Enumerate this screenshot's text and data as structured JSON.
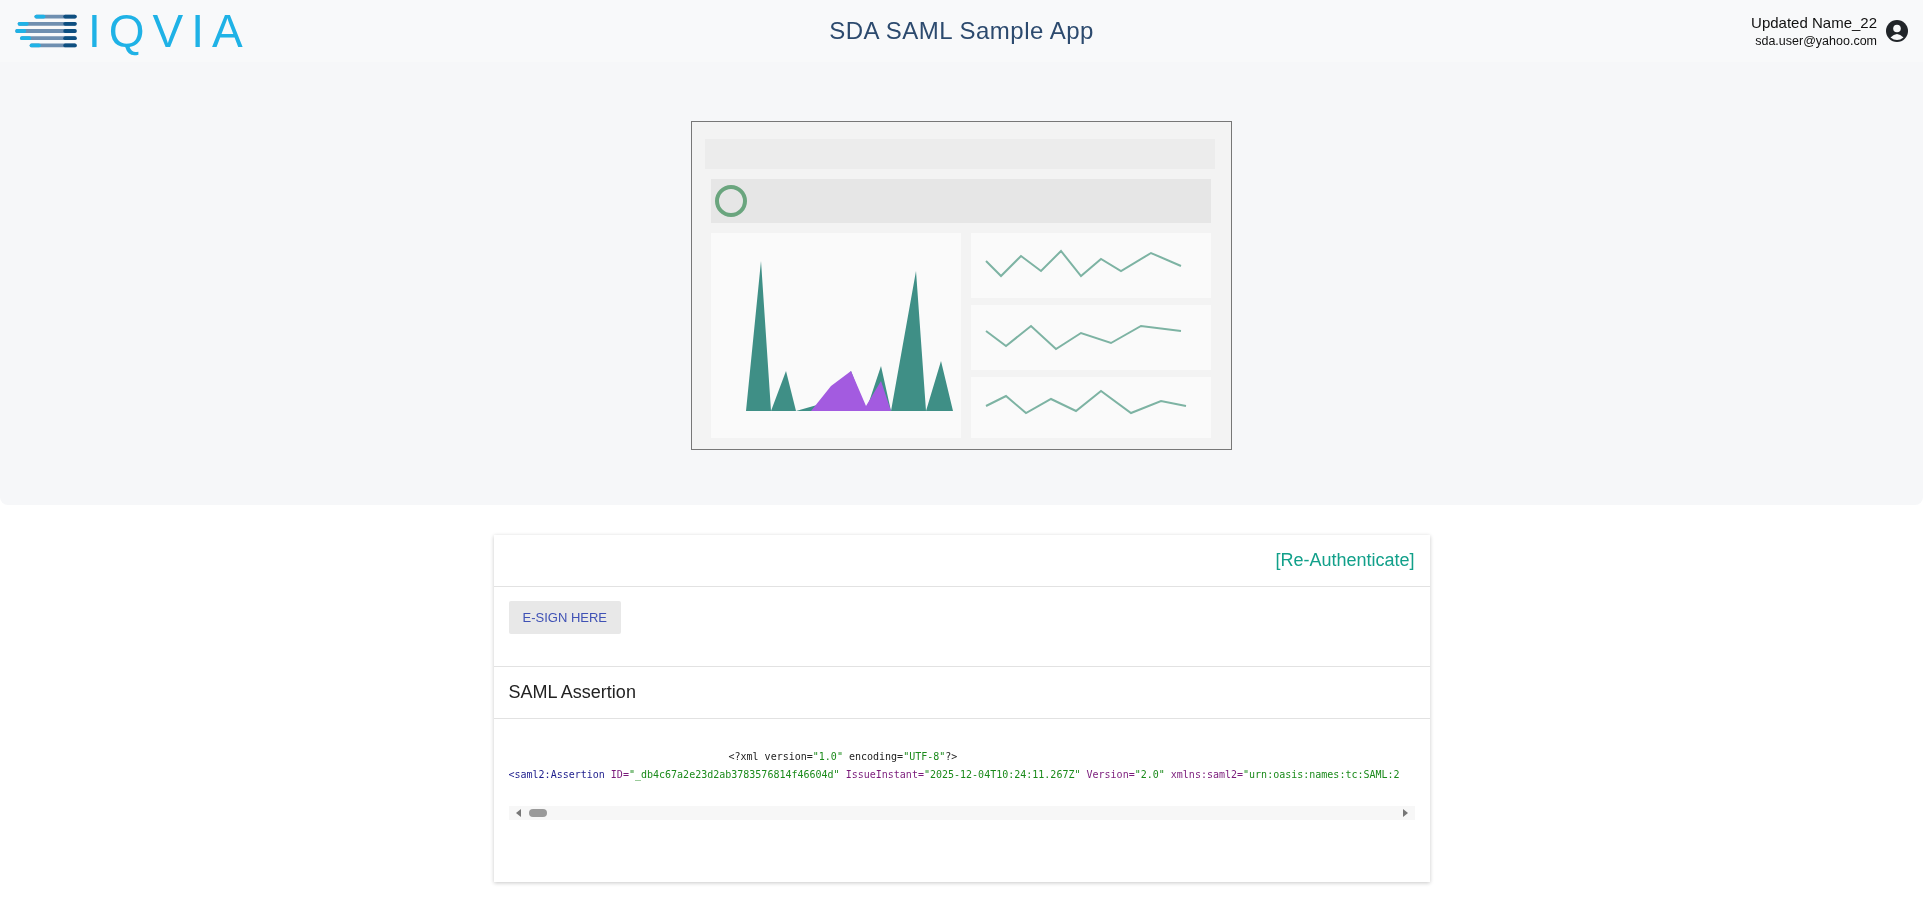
{
  "header": {
    "logo_text": "IQVIA",
    "title": "SDA SAML Sample App",
    "user": {
      "name": "Updated Name_22",
      "email": "sda.user@yahoo.com"
    }
  },
  "card": {
    "reauth_link": "[Re-Authenticate]",
    "esign_button": "E-SIGN HERE",
    "section_title": "SAML Assertion",
    "xml_lines": [
      {
        "tokens": [
          {
            "kind": "decl",
            "text": "<?xml version="
          },
          {
            "kind": "value",
            "text": "\"1.0\""
          },
          {
            "kind": "decl",
            "text": " encoding="
          },
          {
            "kind": "value",
            "text": "\"UTF-8\""
          },
          {
            "kind": "decl",
            "text": "?>"
          }
        ]
      },
      {
        "tokens": [
          {
            "kind": "tag",
            "text": "<saml2:Assertion"
          },
          {
            "kind": "attr",
            "text": " ID="
          },
          {
            "kind": "value",
            "text": "\"_db4c67a2e23d2ab3783576814f46604d\""
          },
          {
            "kind": "attr",
            "text": " IssueInstant="
          },
          {
            "kind": "value",
            "text": "\"2025-12-04T10:24:11.267Z\""
          },
          {
            "kind": "attr",
            "text": " Version="
          },
          {
            "kind": "value",
            "text": "\"2.0\""
          },
          {
            "kind": "attr",
            "text": " xmlns:saml2="
          },
          {
            "kind": "value",
            "text": "\"urn:oasis:names:tc:SAML:2"
          }
        ]
      }
    ]
  }
}
